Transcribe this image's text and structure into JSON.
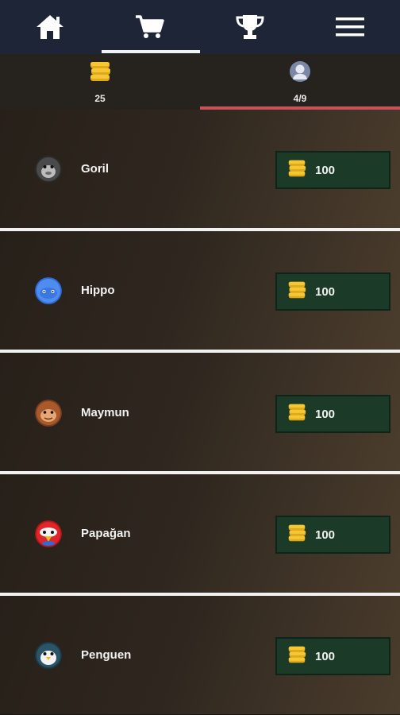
{
  "nav": {
    "tabs": [
      {
        "name": "home",
        "icon": "home-icon"
      },
      {
        "name": "shop",
        "icon": "cart-icon",
        "active": true
      },
      {
        "name": "leaderboard",
        "icon": "trophy-icon"
      },
      {
        "name": "menu",
        "icon": "hamburger-menu-icon"
      }
    ]
  },
  "stats": {
    "coins": "25",
    "characters": "4/9"
  },
  "items": [
    {
      "name": "Goril",
      "price": "100",
      "icon": "gorilla-icon"
    },
    {
      "name": "Hippo",
      "price": "100",
      "icon": "hippo-icon"
    },
    {
      "name": "Maymun",
      "price": "100",
      "icon": "monkey-icon"
    },
    {
      "name": "Papağan",
      "price": "100",
      "icon": "parrot-icon"
    },
    {
      "name": "Penguen",
      "price": "100",
      "icon": "penguin-icon"
    }
  ],
  "colors": {
    "navbar": "#1d2536",
    "statsbar": "#26221d",
    "buy_button": "#1b3a27",
    "active_underline": "#c9525a",
    "coin": "#f3c22b"
  }
}
